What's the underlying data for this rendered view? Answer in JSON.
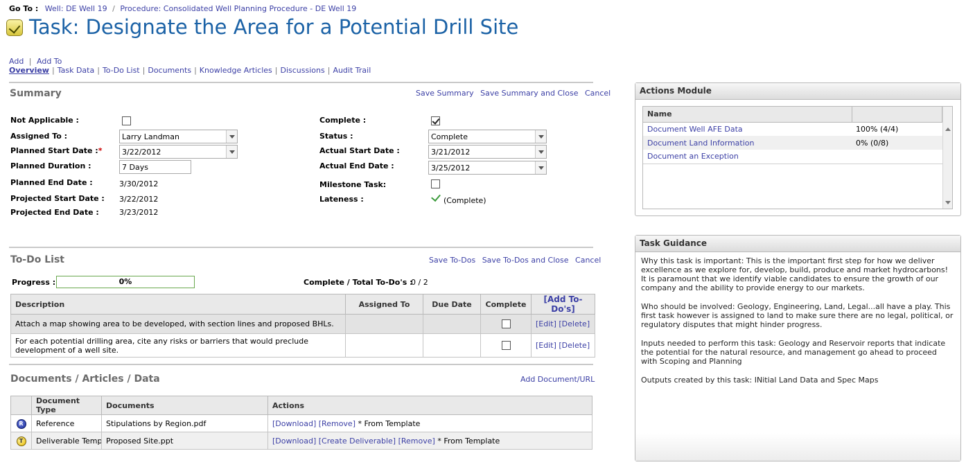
{
  "breadcrumb": {
    "label": "Go To :",
    "items": [
      "Well: DE Well 19",
      "Procedure: Consolidated Well Planning Procedure - DE Well 19"
    ],
    "separator": "/"
  },
  "page_title": "Task: Designate the Area for a Potential Drill Site",
  "action_links": [
    "Add",
    "Add To"
  ],
  "nav_tabs": [
    "Overview",
    "Task Data",
    "To-Do List",
    "Documents",
    "Knowledge Articles",
    "Discussions",
    "Audit Trail"
  ],
  "summary": {
    "title": "Summary",
    "actions": [
      "Save Summary",
      "Save Summary and Close",
      "Cancel"
    ],
    "left": {
      "not_applicable": "Not Applicable :",
      "assigned_to": "Assigned To :",
      "assigned_to_value": "Larry Landman",
      "planned_start": "Planned Start Date :",
      "planned_start_required": "*",
      "planned_start_value": "3/22/2012",
      "planned_duration": "Planned Duration :",
      "planned_duration_value": "7 Days",
      "planned_end": "Planned End Date :",
      "planned_end_value": "3/30/2012",
      "projected_start": "Projected Start Date :",
      "projected_start_value": "3/22/2012",
      "projected_end": "Projected End Date :",
      "projected_end_value": "3/23/2012"
    },
    "right": {
      "complete": "Complete :",
      "status": "Status :",
      "status_value": "Complete",
      "actual_start": "Actual Start Date :",
      "actual_start_value": "3/21/2012",
      "actual_end": "Actual End Date :",
      "actual_end_value": "3/25/2012",
      "milestone": "Milestone Task:",
      "lateness": "Lateness :",
      "lateness_value": "(Complete)"
    }
  },
  "todo": {
    "title": "To-Do List",
    "actions": [
      "Save To-Dos",
      "Save To-Dos and Close",
      "Cancel"
    ],
    "progress_label": "Progress :",
    "progress_value": "0%",
    "progress_fraction": 0,
    "complete_total_label": "Complete / Total To-Do's :",
    "complete_total_value": "0 / 2",
    "columns": [
      "Description",
      "Assigned To",
      "Due Date",
      "Complete",
      "[Add To-Do's]"
    ],
    "rows": [
      {
        "description": "Attach a map showing area to be developed, with section lines and proposed BHLs.",
        "assigned_to": "",
        "due_date": "",
        "edit": "[Edit]",
        "delete": "[Delete]"
      },
      {
        "description": "For each potential drilling area, cite any risks or barriers that would preclude development of a well site.",
        "assigned_to": "",
        "due_date": "",
        "edit": "[Edit]",
        "delete": "[Delete]"
      }
    ]
  },
  "documents": {
    "title": "Documents / Articles / Data",
    "add_link": "Add Document/URL",
    "columns": [
      "Document Type",
      "Documents",
      "Actions"
    ],
    "rows": [
      {
        "icon": "R",
        "type": "Reference",
        "document": "Stipulations by Region.pdf",
        "links": [
          "[Download]",
          "[Remove]"
        ],
        "note": "* From Template"
      },
      {
        "icon": "T",
        "type": "Deliverable Template",
        "document": "Proposed Site.ppt",
        "links": [
          "[Download]",
          "[Create Deliverable]",
          "[Remove]"
        ],
        "note": "* From Template"
      }
    ]
  },
  "actions_module": {
    "title": "Actions Module",
    "columns": [
      "Name",
      ""
    ],
    "rows": [
      {
        "name": "Document Well AFE Data",
        "progress": "100% (4/4)"
      },
      {
        "name": "Document Land Information",
        "progress": "0% (0/8)"
      },
      {
        "name": "Document an Exception",
        "progress": ""
      }
    ]
  },
  "task_guidance": {
    "title": "Task Guidance",
    "paragraphs": [
      "Why this task is important:  This is the important first step for how we deliver excellence as we explore for, develop, build, produce and market hydrocarbons!  It is paramount that we identify viable candidates to ensure the growth of our company and the ability to provide energy to our markets.",
      "Who should be involved:   Geology, Engineering, Land, Legal...all have a play.  This first task however is assigned to land to make sure there are no legal, political, or regulatory disputes that might hinder progress.",
      "Inputs needed to perform this task:   Geology and Reservoir reports that indicate the potential for the natural resource, and management go ahead to proceed with Scoping and Planning",
      "Outputs created by this task:  INitial Land Data and Spec Maps"
    ]
  },
  "colors": {
    "title": "#1b62a6",
    "link": "#3b3fa5",
    "header_bg": "#e9e9e9",
    "progress_border": "#6aa84f"
  }
}
